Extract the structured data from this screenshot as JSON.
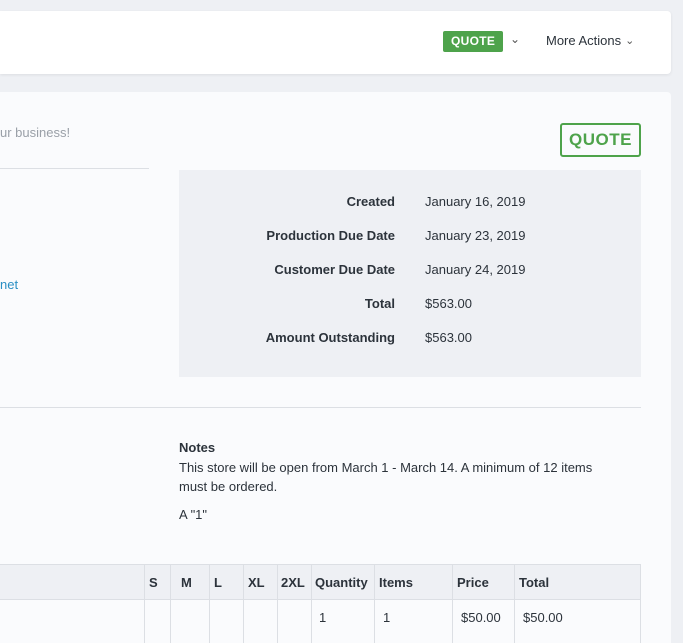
{
  "header": {
    "status": "QUOTE",
    "more_actions_label": "More Actions"
  },
  "intro": {
    "tagline": "ur business!",
    "link_fragment": "net"
  },
  "stamp": {
    "label": "QUOTE"
  },
  "summary": {
    "rows": [
      {
        "label": "Created",
        "value": "January 16, 2019"
      },
      {
        "label": "Production Due Date",
        "value": "January 23, 2019"
      },
      {
        "label": "Customer Due Date",
        "value": "January 24, 2019"
      },
      {
        "label": "Total",
        "value": "$563.00"
      },
      {
        "label": "Amount Outstanding",
        "value": "$563.00"
      }
    ]
  },
  "notes": {
    "title": "Notes",
    "body": "This store will be open from March 1 - March 14. A minimum of 12 items must be ordered.",
    "extra": "A \"1\""
  },
  "table": {
    "headers": [
      "S",
      "M",
      "L",
      "XL",
      "2XL",
      "Quantity",
      "Items",
      "Price",
      "Total"
    ],
    "rows": [
      {
        "S": "",
        "M": "",
        "L": "",
        "XL": "",
        "2XL": "",
        "quantity": "1",
        "items": "1",
        "price": "$50.00",
        "total": "$50.00"
      }
    ]
  },
  "colors": {
    "accent_green": "#4ea34b",
    "link_blue": "#2a8fc4",
    "background": "#eef0f4"
  }
}
